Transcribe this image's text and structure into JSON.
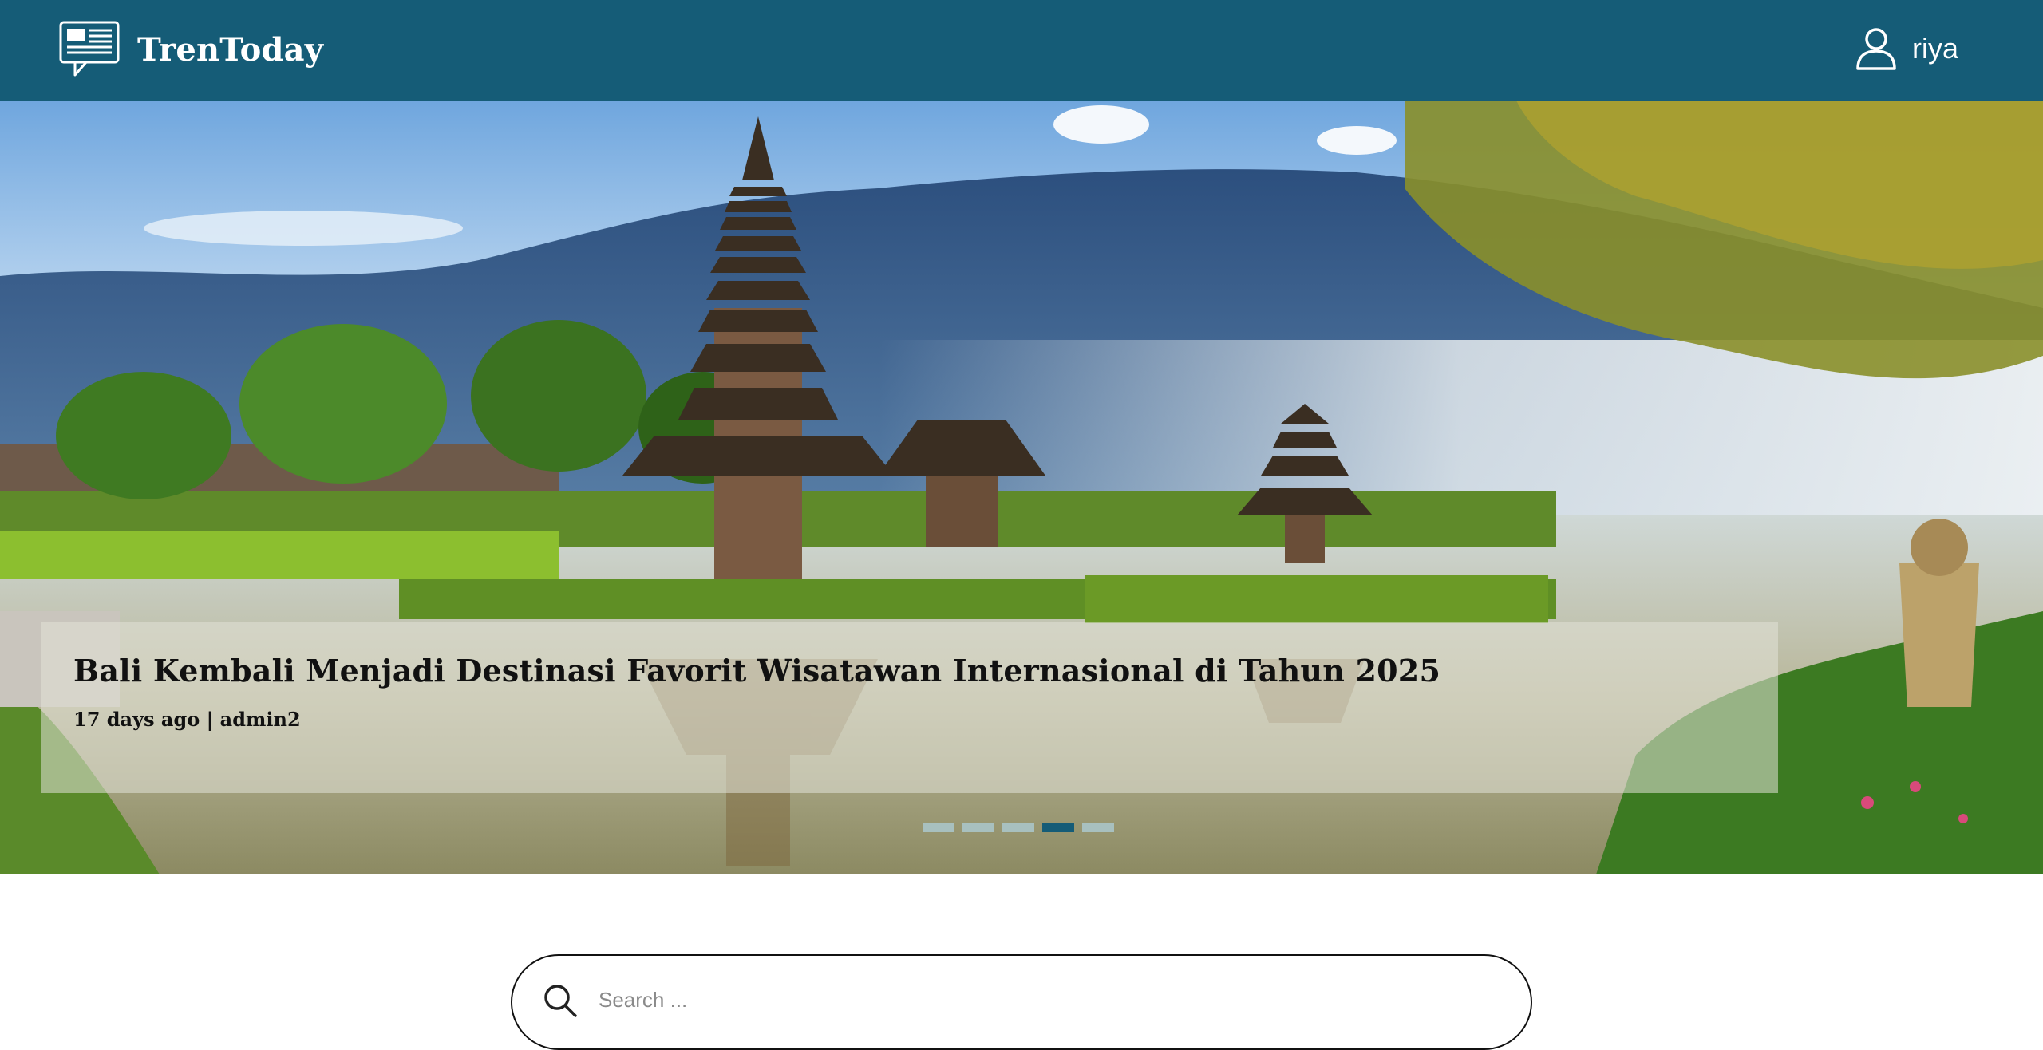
{
  "header": {
    "brand_name": "TrenToday",
    "brand_icon": "newspaper-chat-icon",
    "user_icon": "user-outline-icon",
    "user_name": "riya",
    "background_color": "#155c77"
  },
  "hero": {
    "image": "bali-lake-temple-photo",
    "title": "Bali Kembali Menjadi Destinasi Favorit Wisatawan Internasional di Tahun 2025",
    "meta": "17 days ago | admin2",
    "slide_count": 5,
    "active_slide": 4,
    "active_dot_color": "#155c77"
  },
  "search": {
    "placeholder": "Search ...",
    "value": "",
    "icon": "search-icon"
  }
}
